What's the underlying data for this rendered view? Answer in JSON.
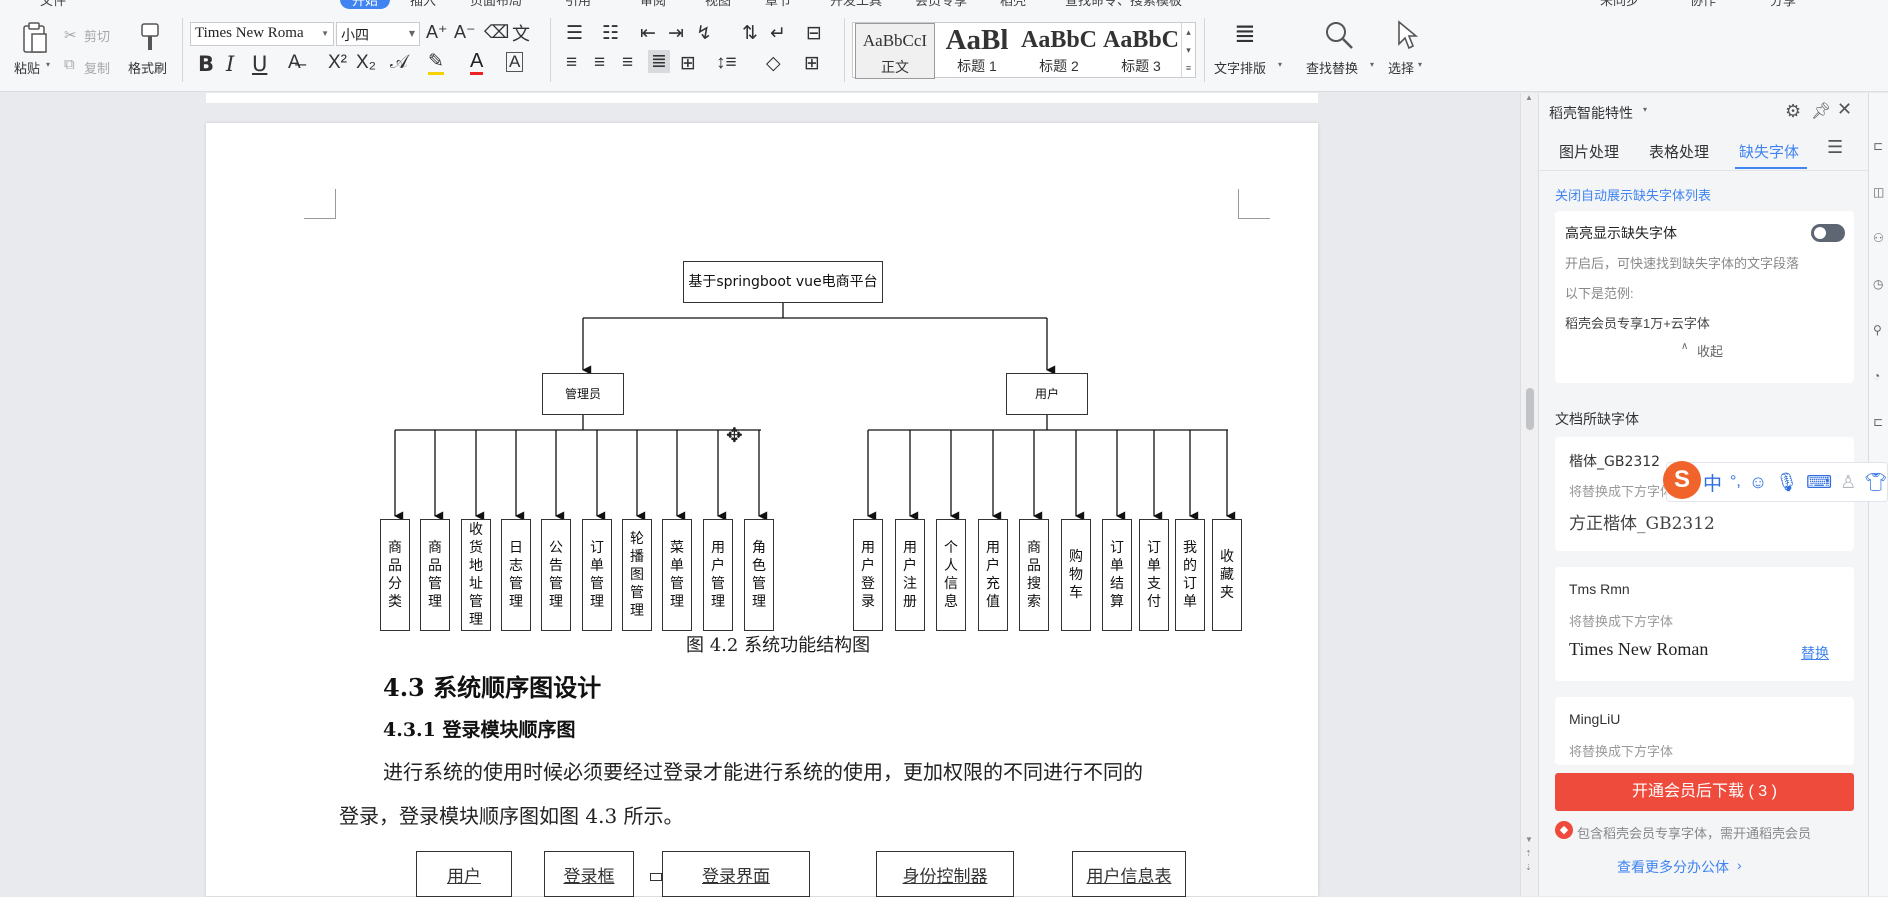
{
  "ribbon": {
    "tabs": [
      "文件",
      "开始",
      "插入",
      "页面布局",
      "引用",
      "审阅",
      "视图",
      "章节",
      "开发工具",
      "会员专享",
      "稻壳",
      "查找命令、搜索模板",
      "未同步",
      "协作",
      "分享"
    ],
    "paste_label": "粘贴",
    "cut_label": "剪切",
    "copy_label": "复制",
    "format_painter_label": "格式刷",
    "font_name": "Times New Roma",
    "font_size": "小四",
    "styles": [
      {
        "preview": "AaBbCcI",
        "name": "正文"
      },
      {
        "preview": "AaBl",
        "name": "标题 1"
      },
      {
        "preview": "AaBbC",
        "name": "标题 2"
      },
      {
        "preview": "AaBbC",
        "name": "标题 3"
      }
    ],
    "text_layout_label": "文字排版",
    "find_replace_label": "查找替换",
    "select_label": "选择",
    "bold": "B",
    "italic": "I",
    "underline": "U"
  },
  "document": {
    "diagram": {
      "root": "基于springboot vue电商平台",
      "admin": "管理员",
      "user": "用户",
      "admin_modules": [
        "商品分类",
        "商品管理",
        "收货地址管理",
        "日志管理",
        "公告管理",
        "订单管理",
        "轮播图管理",
        "菜单管理",
        "用户管理",
        "角色管理"
      ],
      "user_modules": [
        "用户登录",
        "用户注册",
        "个人信息",
        "用户充值",
        "商品搜索",
        "购物车",
        "订单结算",
        "订单支付",
        "我的订单",
        "收藏夹"
      ]
    },
    "caption": "图 4.2    系统功能结构图",
    "heading_43": "4.3  系统顺序图设计",
    "heading_431": "4.3.1 登录模块顺序图",
    "para_line1": "进行系统的使用时候必须要经过登录才能进行系统的使用，更加权限的不同进行不同的",
    "para_line2": "登录，登录模块顺序图如图 4.3 所示。",
    "sequence_boxes": [
      "用户",
      "登录框",
      "登录界面",
      "身份控制器",
      "用户信息表"
    ]
  },
  "panel": {
    "title": "稻壳智能特性",
    "tabs": [
      "图片处理",
      "表格处理",
      "缺失字体"
    ],
    "close_auto_link": "关闭自动展示缺失字体列表",
    "highlight_title": "高亮显示缺失字体",
    "highlight_desc": "开启后，可快速找到缺失字体的文字段落",
    "example_label": "以下是范例:",
    "example_text": "稻壳会员专享1万+云字体",
    "collapse_label": "收起",
    "missing_section_title": "文档所缺字体",
    "missing_fonts": [
      {
        "name": "楷体_GB2312",
        "replace_hint": "将替换成下方字体",
        "replacement": "方正楷体_GB2312",
        "action": ""
      },
      {
        "name": "Tms Rmn",
        "replace_hint": "将替换成下方字体",
        "replacement": "Times New Roman",
        "action": "替换"
      },
      {
        "name": "MingLiU",
        "replace_hint": "将替换成下方字体",
        "replacement": "",
        "action": ""
      }
    ],
    "download_button": "开通会员后下载 ( 3 )",
    "vip_note": "包含稻壳会员专享字体，需开通稻壳会员",
    "more_link": "查看更多分办公体"
  },
  "ime": {
    "logo": "S",
    "mode": "中",
    "punct": "°,"
  },
  "colors": {
    "accent": "#3f84f0",
    "download_button": "#ef4b3c",
    "link": "#3f84f0"
  }
}
